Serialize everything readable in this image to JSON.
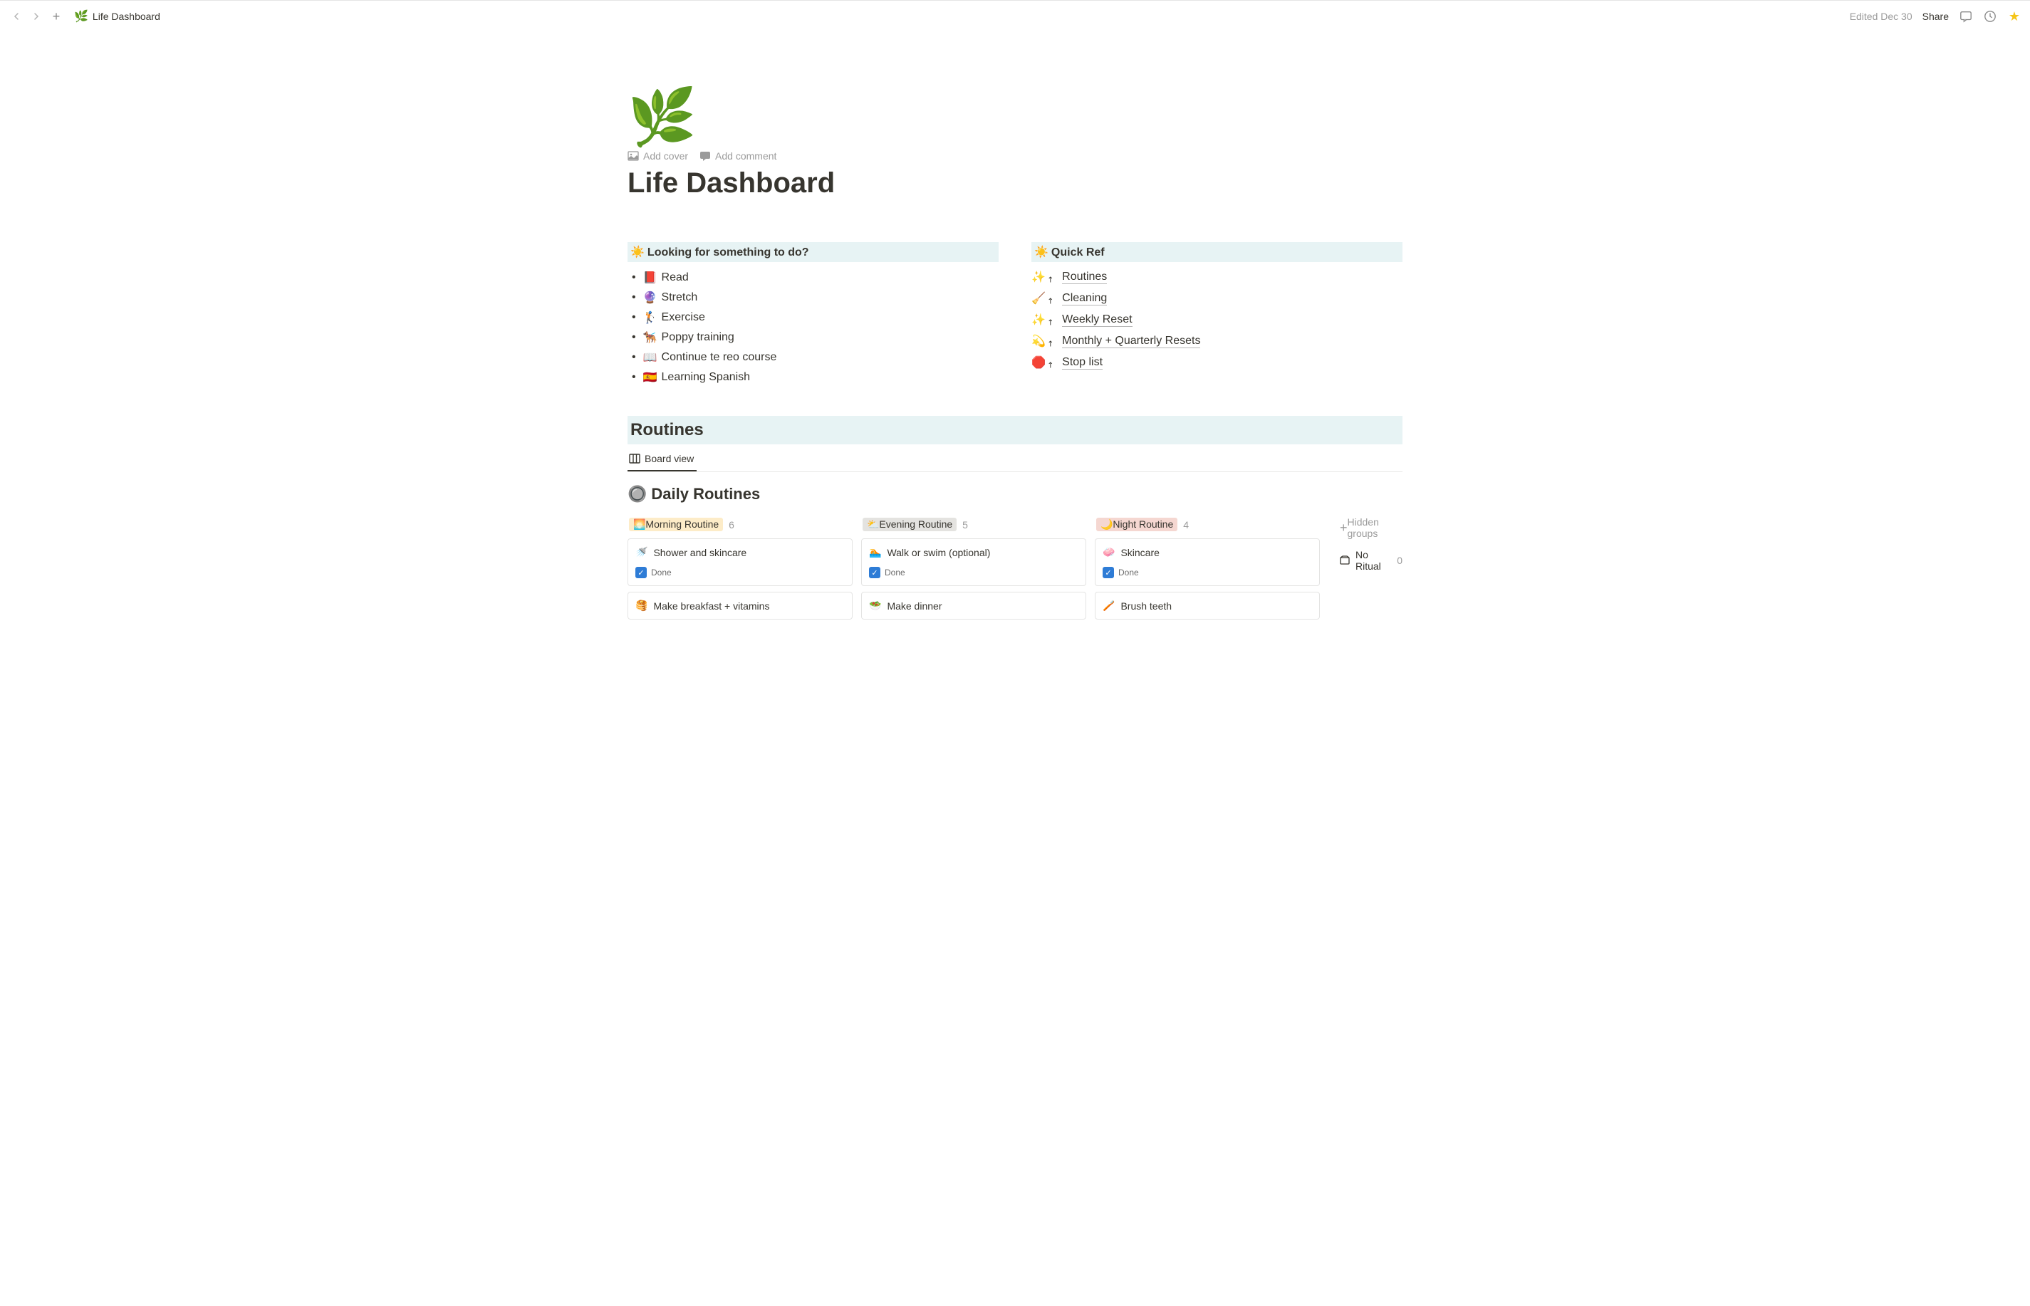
{
  "topbar": {
    "breadcrumb_icon": "🌿",
    "breadcrumb_title": "Life Dashboard",
    "edited": "Edited Dec 30",
    "share": "Share"
  },
  "page": {
    "icon": "🌿",
    "add_cover": "Add cover",
    "add_comment": "Add comment",
    "title": "Life Dashboard"
  },
  "todo_section": {
    "header": "Looking for something to do?",
    "header_emoji": "☀️",
    "items": [
      {
        "emoji": "📕",
        "text": "Read"
      },
      {
        "emoji": "🔮",
        "text": "Stretch"
      },
      {
        "emoji": "🏌️",
        "text": "Exercise"
      },
      {
        "emoji": "🐕‍🦺",
        "text": "Poppy training"
      },
      {
        "emoji": "📖",
        "text": "Continue te reo course"
      },
      {
        "emoji": "🇪🇸",
        "text": "Learning Spanish"
      }
    ]
  },
  "quickref_section": {
    "header": "Quick Ref",
    "header_emoji": "☀️",
    "items": [
      {
        "emoji": "✨",
        "text": "Routines"
      },
      {
        "emoji": "🧹",
        "text": "Cleaning"
      },
      {
        "emoji": "✨",
        "text": "Weekly Reset"
      },
      {
        "emoji": "💫",
        "text": "Monthly + Quarterly Resets"
      },
      {
        "emoji": "🛑",
        "text": "Stop list"
      }
    ]
  },
  "routines": {
    "header": "Routines",
    "view_tab": "Board view",
    "daily_emoji": "🔘",
    "daily_title": "Daily Routines",
    "hidden_label": "Hidden groups",
    "no_ritual_label": "No Ritual",
    "no_ritual_count": "0",
    "columns": [
      {
        "tag_emoji": "🌅",
        "tag_label": "Morning Routine",
        "tag_class": "tag-morning",
        "count": "6",
        "cards": [
          {
            "emoji": "🚿",
            "title": "Shower and skincare",
            "done_label": "Done"
          },
          {
            "emoji": "🥞",
            "title": "Make breakfast + vitamins"
          }
        ]
      },
      {
        "tag_emoji": "⛅",
        "tag_label": "Evening Routine",
        "tag_class": "tag-evening",
        "count": "5",
        "cards": [
          {
            "emoji": "🏊",
            "title": "Walk or swim (optional)",
            "done_label": "Done"
          },
          {
            "emoji": "🥗",
            "title": "Make dinner"
          }
        ]
      },
      {
        "tag_emoji": "🌙",
        "tag_label": "Night Routine",
        "tag_class": "tag-night",
        "count": "4",
        "cards": [
          {
            "emoji": "🧼",
            "title": "Skincare",
            "done_label": "Done"
          },
          {
            "emoji": "🪥",
            "title": "Brush teeth"
          }
        ]
      }
    ]
  }
}
